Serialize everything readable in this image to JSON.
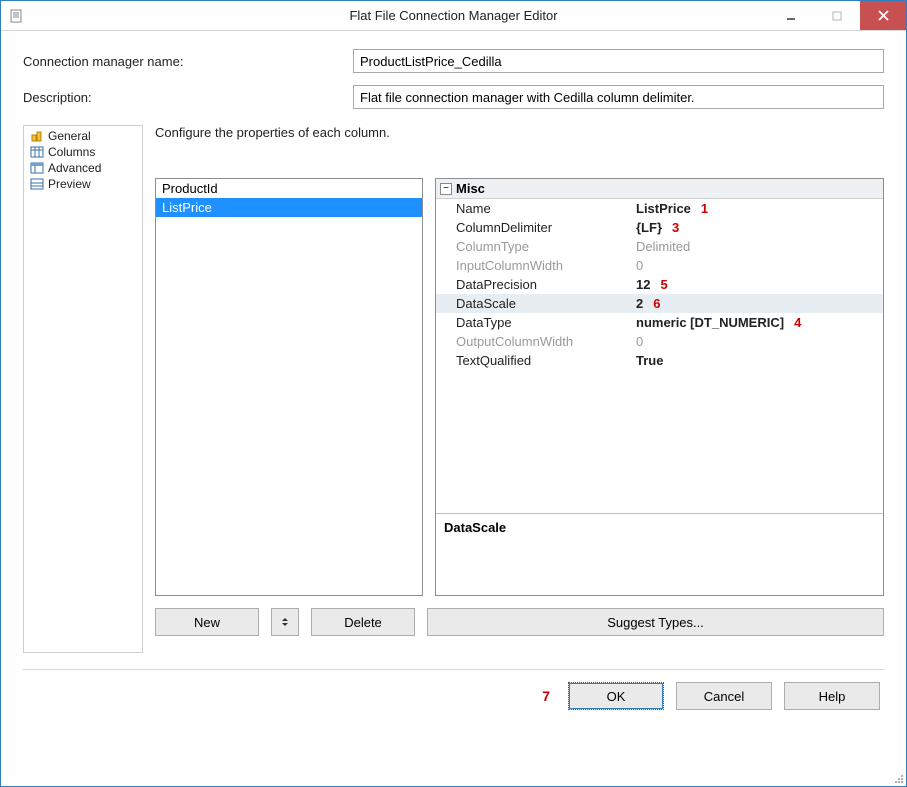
{
  "window": {
    "title": "Flat File Connection Manager Editor"
  },
  "fields": {
    "connection_name_label": "Connection manager name:",
    "connection_name_value": "ProductListPrice_Cedilla",
    "description_label": "Description:",
    "description_value": "Flat file connection manager with Cedilla column delimiter."
  },
  "sidebar": {
    "items": [
      {
        "label": "General"
      },
      {
        "label": "Columns"
      },
      {
        "label": "Advanced"
      },
      {
        "label": "Preview"
      }
    ],
    "selected_index": 2
  },
  "main": {
    "instruction": "Configure the properties of each column.",
    "columns": [
      "ProductId",
      "ListPrice"
    ],
    "selected_column_index": 1,
    "prop_category": "Misc",
    "properties": [
      {
        "name": "Name",
        "value": "ListPrice",
        "bold": true,
        "annot": "1"
      },
      {
        "name": "ColumnDelimiter",
        "value": "{LF}",
        "bold": true,
        "annot": "3"
      },
      {
        "name": "ColumnType",
        "value": "Delimited",
        "disabled": true
      },
      {
        "name": "InputColumnWidth",
        "value": "0",
        "disabled": true
      },
      {
        "name": "DataPrecision",
        "value": "12",
        "bold": true,
        "annot": "5"
      },
      {
        "name": "DataScale",
        "value": "2",
        "bold": true,
        "annot": "6",
        "selected": true
      },
      {
        "name": "DataType",
        "value": "numeric [DT_NUMERIC]",
        "bold": true,
        "annot": "4"
      },
      {
        "name": "OutputColumnWidth",
        "value": "0",
        "disabled": true
      },
      {
        "name": "TextQualified",
        "value": "True",
        "bold": true
      }
    ],
    "prop_description_title": "DataScale",
    "buttons": {
      "new": "New",
      "delete": "Delete",
      "suggest": "Suggest Types..."
    }
  },
  "dialog_buttons": {
    "ok": "OK",
    "cancel": "Cancel",
    "help": "Help",
    "ok_annot": "7"
  }
}
